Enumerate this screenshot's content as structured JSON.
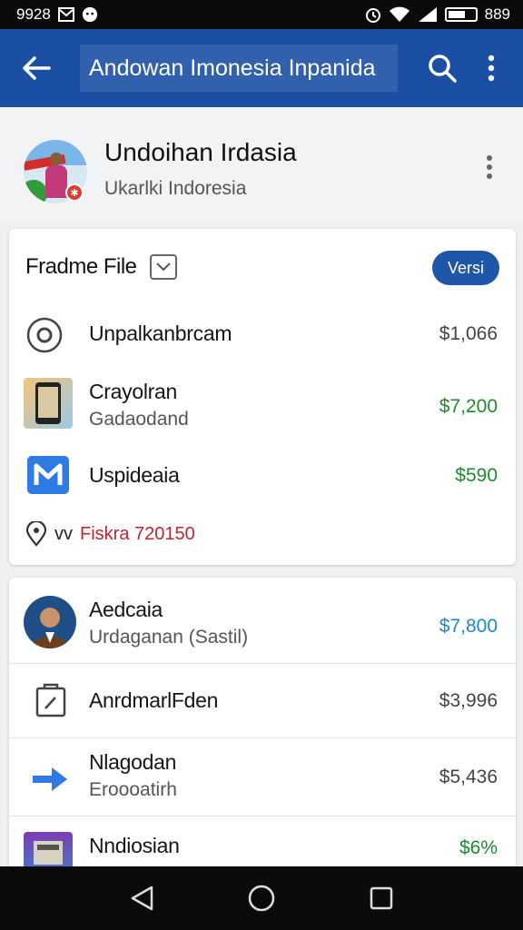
{
  "status_bar": {
    "time": "9928",
    "right_text": "889"
  },
  "app_bar": {
    "title": "Andowan Imonesia Inpanida"
  },
  "profile": {
    "name": "Undoihan Irdasia",
    "subtitle": "Ukarlki Indoresia"
  },
  "card1": {
    "header_title": "Fradme File",
    "badge_label": "Versi",
    "rows": [
      {
        "title": "Unpalkanbrcam",
        "amount": "$1,066",
        "amount_color": "#444444"
      },
      {
        "title": "Crayolran",
        "subtitle": "Gadaodand",
        "amount": "$7,200",
        "amount_color": "#1e8a2e"
      },
      {
        "title": "Uspideaia",
        "amount": "$590",
        "amount_color": "#1e8a2e"
      }
    ],
    "location": {
      "prefix": "vv",
      "value": "Fiskra 720150"
    }
  },
  "card2": {
    "rows": [
      {
        "title": "Aedcaia",
        "subtitle": "Urdaganan (Sastil)",
        "amount": "$7,800",
        "amount_color": "#1f88c9"
      },
      {
        "title": "AnrdmarlFden",
        "amount": "$3,996",
        "amount_color": "#444444"
      },
      {
        "title": "Nlagodan",
        "subtitle": "Eroooatirh",
        "amount": "$5,436",
        "amount_color": "#444444"
      },
      {
        "title": "Nndiosian",
        "amount": "$6%",
        "amount_color": "#1e8a2e"
      }
    ]
  },
  "colors": {
    "primary": "#1a4fa3",
    "badge": "#1f56a8",
    "location_red": "#c3232b"
  }
}
